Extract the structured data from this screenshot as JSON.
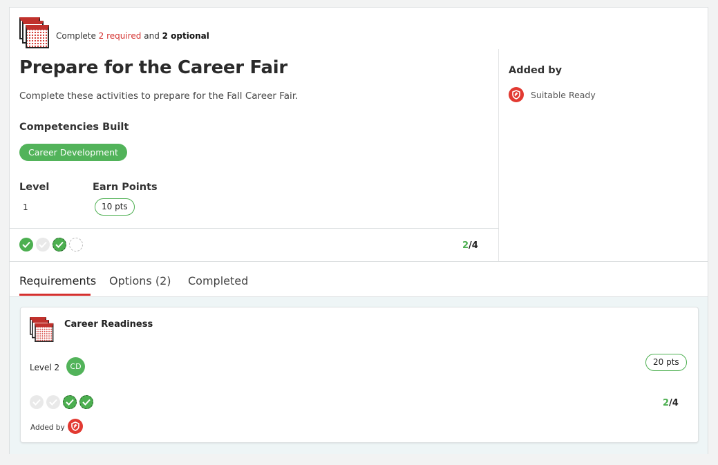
{
  "header": {
    "icon": "activity-stack-icon",
    "summary_prefix": "Complete",
    "required_text": "2 required",
    "summary_and": "and",
    "optional_text": "2 optional"
  },
  "activity": {
    "title": "Prepare for the Career Fair",
    "description": "Complete these activities to prepare for the Fall Career Fair.",
    "competencies_heading": "Competencies Built",
    "competency": "Career Development",
    "level_heading": "Level",
    "level_value": "1",
    "points_heading": "Earn Points",
    "points_value": "10 pts",
    "progress_done": "2",
    "progress_sep": "/",
    "progress_total": "4"
  },
  "sidebar": {
    "added_by_heading": "Added by",
    "added_by_name": "Suitable Ready"
  },
  "tabs": [
    {
      "label": "Requirements",
      "active": true
    },
    {
      "label": "Options (2)",
      "active": false
    },
    {
      "label": "Completed",
      "active": false
    }
  ],
  "requirement_item": {
    "title": "Career Readiness",
    "level": "Level 2",
    "competency_abbr": "CD",
    "points": "20 pts",
    "progress_done": "2",
    "progress_sep": "/",
    "progress_total": "4",
    "added_by_label": "Added by"
  },
  "colors": {
    "accent_red": "#d4312f",
    "success_green": "#4caf50"
  }
}
